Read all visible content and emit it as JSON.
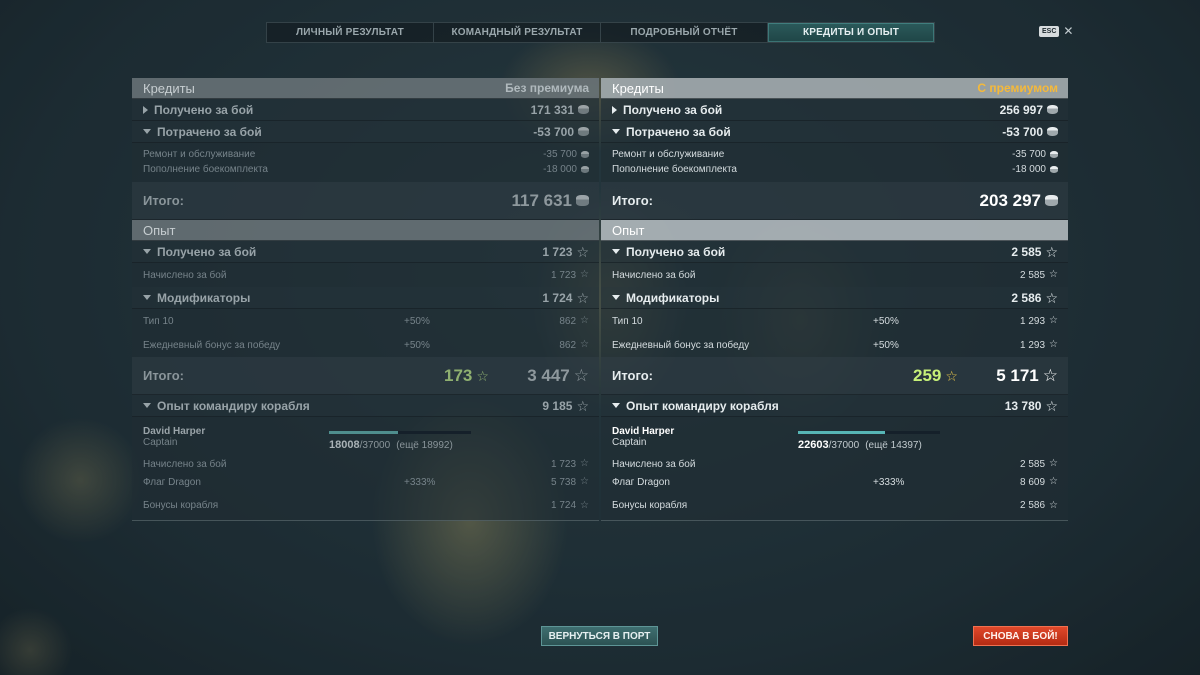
{
  "tabs": [
    {
      "label": "ЛИЧНЫЙ РЕЗУЛЬТАТ"
    },
    {
      "label": "КОМАНДНЫЙ РЕЗУЛЬТАТ"
    },
    {
      "label": "ПОДРОБНЫЙ ОТЧЁТ"
    },
    {
      "label": "КРЕДИТЫ И ОПЫТ"
    }
  ],
  "active_tab": "КРЕДИТЫ И ОПЫТ",
  "esc_label": "ESC",
  "close_symbol": "✕",
  "left": {
    "credits_title": "Кредиты",
    "status": "Без премиума",
    "earned_label": "Получено за бой",
    "earned_value": "171 331",
    "spent_label": "Потрачено за бой",
    "spent_value": "-53 700",
    "repair_label": "Ремонт и обслуживание",
    "repair_value": "-35 700",
    "ammo_label": "Пополнение боекомплекта",
    "ammo_value": "-18 000",
    "credits_total_label": "Итого:",
    "credits_total_value": "117 631",
    "xp_title": "Опыт",
    "xp_earned_label": "Получено за бой",
    "xp_earned_value": "1 723",
    "xp_accrued_label": "Начислено за бой",
    "xp_accrued_value": "1 723",
    "mods_label": "Модификаторы",
    "mods_value": "1 724",
    "tier_label": "Тип 10",
    "tier_pct": "+50%",
    "tier_value": "862",
    "daily_label": "Ежедневный бонус за победу",
    "daily_pct": "+50%",
    "daily_value": "862",
    "xp_total_label": "Итого:",
    "xp_free": "173",
    "xp_total_value": "3 447",
    "cmdr_label": "Опыт командиру корабля",
    "cmdr_value": "9 185",
    "captain_name": "David Harper",
    "captain_rank": "Captain",
    "captain_xp": "18008",
    "captain_xp_max": "/37000",
    "captain_remaining": "(ещё 18992)",
    "captain_progress": 0.487,
    "cmdr_accrued_label": "Начислено за бой",
    "cmdr_accrued_value": "1 723",
    "flag_label": "Флаг Dragon",
    "flag_pct": "+333%",
    "flag_value": "5 738",
    "ship_bonus_label": "Бонусы корабля",
    "ship_bonus_value": "1 724"
  },
  "right": {
    "credits_title": "Кредиты",
    "status": "С премиумом",
    "earned_label": "Получено за бой",
    "earned_value": "256 997",
    "spent_label": "Потрачено за бой",
    "spent_value": "-53 700",
    "repair_label": "Ремонт и обслуживание",
    "repair_value": "-35 700",
    "ammo_label": "Пополнение боекомплекта",
    "ammo_value": "-18 000",
    "credits_total_label": "Итого:",
    "credits_total_value": "203 297",
    "xp_title": "Опыт",
    "xp_earned_label": "Получено за бой",
    "xp_earned_value": "2 585",
    "xp_accrued_label": "Начислено за бой",
    "xp_accrued_value": "2 585",
    "mods_label": "Модификаторы",
    "mods_value": "2 586",
    "tier_label": "Тип 10",
    "tier_pct": "+50%",
    "tier_value": "1 293",
    "daily_label": "Ежедневный бонус за победу",
    "daily_pct": "+50%",
    "daily_value": "1 293",
    "xp_total_label": "Итого:",
    "xp_free": "259",
    "xp_total_value": "5 171",
    "cmdr_label": "Опыт командиру корабля",
    "cmdr_value": "13 780",
    "captain_name": "David Harper",
    "captain_rank": "Captain",
    "captain_xp": "22603",
    "captain_xp_max": "/37000",
    "captain_remaining": "(ещё 14397)",
    "captain_progress": 0.611,
    "cmdr_accrued_label": "Начислено за бой",
    "cmdr_accrued_value": "2 585",
    "flag_label": "Флаг Dragon",
    "flag_pct": "+333%",
    "flag_value": "8 609",
    "ship_bonus_label": "Бонусы корабля",
    "ship_bonus_value": "2 586"
  },
  "buttons": {
    "port": "ВЕРНУТЬСЯ В ПОРТ",
    "battle": "СНОВА В БОЙ!"
  },
  "icons": {
    "credits": "credits-coin-icon",
    "xp": "xp-star-icon",
    "expand": "triangle-right-icon",
    "collapse": "triangle-down-icon"
  },
  "colors": {
    "premium_status": "#f5b93a",
    "free_xp": "#c6f078",
    "battle_button": "#c8361c",
    "port_button": "#3a6566",
    "active_tab": "#2b5a5b"
  }
}
